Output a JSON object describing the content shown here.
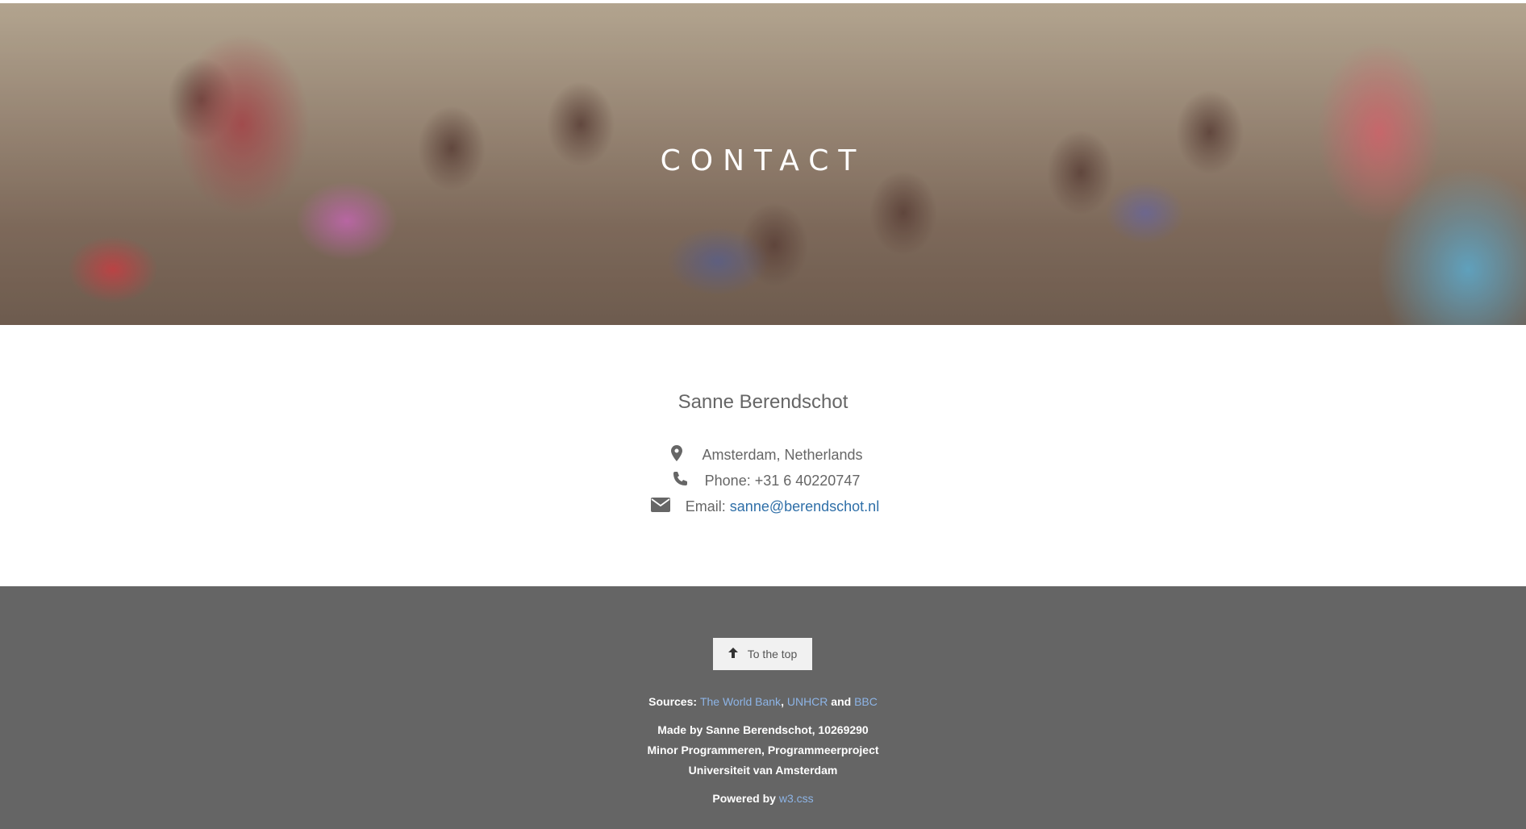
{
  "hero": {
    "title": "CONTACT",
    "image_alt": "group of waving children"
  },
  "contact": {
    "name": "Sanne Berendschot",
    "location": "Amsterdam, Netherlands",
    "phone": "Phone: +31 6 40220747",
    "email_label": "Email:",
    "email": "sanne@berendschot.nl"
  },
  "icons": {
    "location": "map-marker-icon",
    "phone": "phone-icon",
    "email": "envelope-icon",
    "arrow": "arrow-up-icon"
  },
  "footer": {
    "top_button": "To the top",
    "sources_label": "Sources:",
    "source_1": "The World Bank",
    "separator": ",",
    "source_2": "UNHCR",
    "and": "and",
    "source_3": "BBC",
    "made_by": "Made by Sanne Berendschot, 10269290",
    "minor": "Minor Programmeren, Programmeerproject",
    "university": "Universiteit van Amsterdam",
    "powered_label": "Powered by",
    "powered_link": "w3.css"
  },
  "colors": {
    "footer_bg": "#656565",
    "link": "#2f6fa8",
    "footer_link": "#8db4e6"
  }
}
